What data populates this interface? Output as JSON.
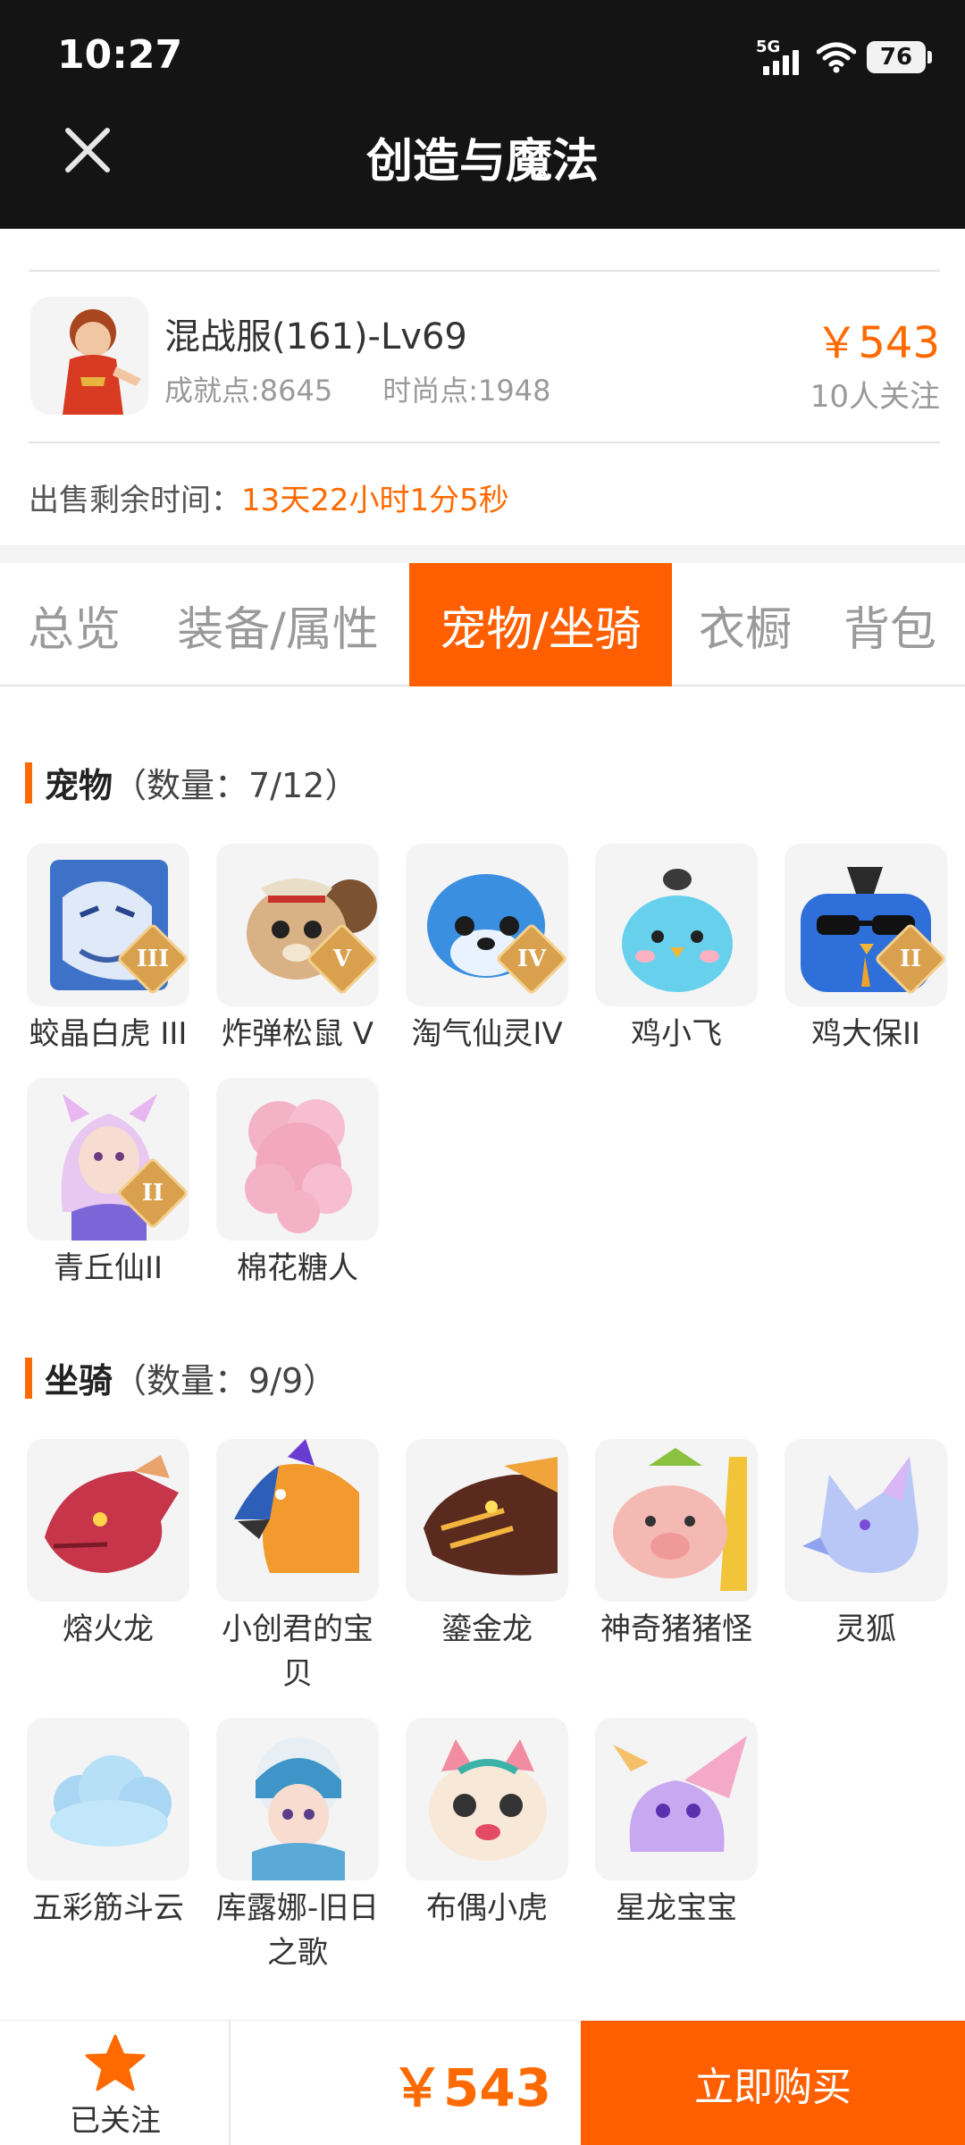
{
  "status": {
    "time": "10:27",
    "network": "5G",
    "battery": "76"
  },
  "header": {
    "title": "创造与魔法"
  },
  "product": {
    "name": "混战服(161)-Lv69",
    "achievement": "成就点:8645",
    "fashion": "时尚点:1948",
    "price": "￥543",
    "followers": "10人关注"
  },
  "sale": {
    "label": "出售剩余时间：",
    "remaining": "13天22小时1分5秒"
  },
  "tabs": [
    {
      "label": "总览"
    },
    {
      "label": "装备/属性"
    },
    {
      "label": "宠物/坐骑",
      "active": true
    },
    {
      "label": "衣橱"
    },
    {
      "label": "背包"
    }
  ],
  "pets": {
    "title": "宠物",
    "count": "（数量：7/12）",
    "items": [
      {
        "label": "蛟晶白虎 III",
        "badge": "III"
      },
      {
        "label": "炸弹松鼠 V",
        "badge": "V"
      },
      {
        "label": "淘气仙灵IV",
        "badge": "IV"
      },
      {
        "label": "鸡小飞",
        "badge": ""
      },
      {
        "label": "鸡大保II",
        "badge": "II"
      },
      {
        "label": "青丘仙II",
        "badge": "II"
      },
      {
        "label": "棉花糖人",
        "badge": ""
      }
    ]
  },
  "mounts": {
    "title": "坐骑",
    "count": "（数量：9/9）",
    "items": [
      {
        "label": "熔火龙"
      },
      {
        "label": "小创君的宝贝"
      },
      {
        "label": "鎏金龙"
      },
      {
        "label": "神奇猪猪怪"
      },
      {
        "label": "灵狐"
      },
      {
        "label": "五彩筋斗云"
      },
      {
        "label": "库露娜-旧日之歌"
      },
      {
        "label": "布偶小虎"
      },
      {
        "label": "星龙宝宝"
      }
    ]
  },
  "bottom": {
    "follow_label": "已关注",
    "price": "￥543",
    "buy_label": "立即购买"
  },
  "colors": {
    "accent": "#ff5f00",
    "price": "#ff6a00",
    "topbar": "#141414"
  }
}
